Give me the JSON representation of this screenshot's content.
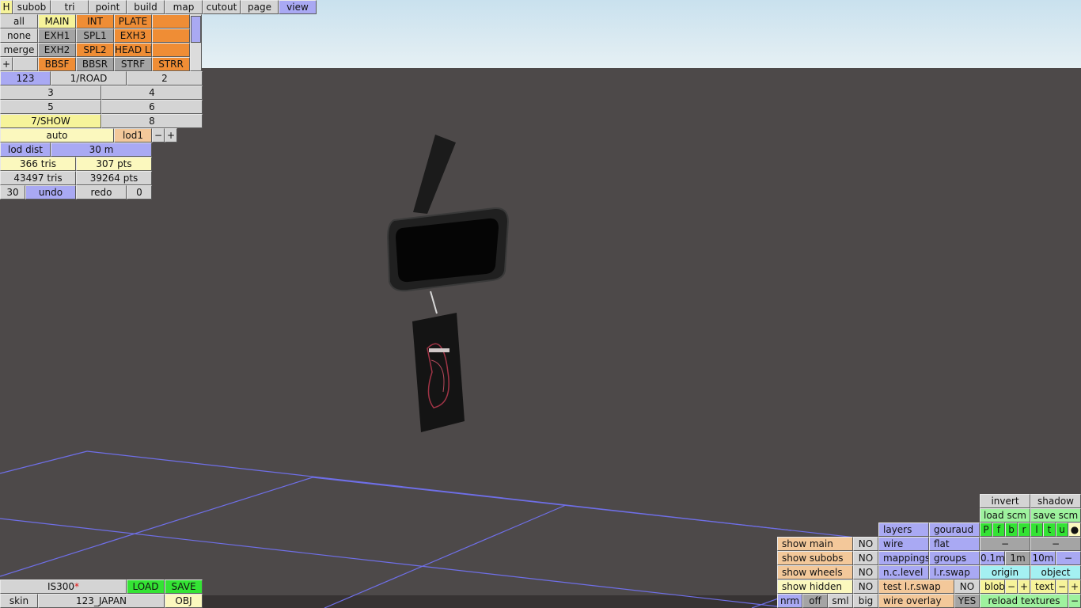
{
  "menu": {
    "h": "H",
    "items": [
      "subob",
      "tri",
      "point",
      "build",
      "map",
      "cutout",
      "page",
      "view"
    ]
  },
  "parts": {
    "row1": [
      "all",
      "MAIN",
      "INT",
      "PLATE",
      ""
    ],
    "row2": [
      "none",
      "EXH1",
      "SPL1",
      "EXH3",
      ""
    ],
    "row3": [
      "merge",
      "EXH2",
      "SPL2",
      "HEAD LI",
      ""
    ],
    "row4": [
      "+",
      "",
      "BBSF",
      "BBSR",
      "STRF",
      "STRR"
    ]
  },
  "groups": {
    "row1": [
      "123",
      "1/ROAD",
      "2"
    ],
    "row2": [
      "3",
      "4"
    ],
    "row3": [
      "5",
      "6"
    ],
    "row4": [
      "7/SHOW",
      "8"
    ]
  },
  "lod": {
    "mode": "auto",
    "level": "lod1",
    "minus": "−",
    "plus": "+",
    "dist_label": "lod dist",
    "dist_value": "30 m"
  },
  "stats": {
    "tris_sel": "366 tris",
    "pts_sel": "307 pts",
    "tris_total": "43497 tris",
    "pts_total": "39264 pts"
  },
  "history": {
    "count": "30",
    "undo": "undo",
    "redo": "redo",
    "redo_count": "0"
  },
  "file": {
    "name": "IS300",
    "modified_mark": "*",
    "load": "LOAD",
    "save": "SAVE",
    "skin_label": "skin",
    "skin_value": "123_JAPAN",
    "obj": "OBJ"
  },
  "view_panel": {
    "invert": "invert",
    "shadow": "shadow",
    "load_scm": "load scm",
    "save_scm": "save scm",
    "layers": "layers",
    "gouraud": "gouraud",
    "light_buttons": [
      "P",
      "f",
      "b",
      "r",
      "l",
      "t",
      "u",
      "●"
    ],
    "show_main": "show main",
    "show_main_val": "NO",
    "wire": "wire",
    "flat": "flat",
    "dash1": "−",
    "dash2": "−",
    "show_subobs": "show subobs",
    "show_subobs_val": "NO",
    "mappings": "mappings",
    "groups": "groups",
    "step_01": "0.1m",
    "step_1": "1m",
    "step_10": "10m",
    "step_minus": "−",
    "show_wheels": "show wheels",
    "show_wheels_val": "NO",
    "nc_level": "n.c.level",
    "lr_swap": "l.r.swap",
    "origin": "origin",
    "object": "object",
    "show_hidden": "show hidden",
    "show_hidden_val": "NO",
    "test_lr_swap": "test l.r.swap",
    "test_lr_swap_val": "NO",
    "blob": "blob",
    "blob_minus": "−",
    "blob_plus": "+",
    "text": "text",
    "text_minus": "−",
    "text_plus": "+",
    "nrm": "nrm",
    "off": "off",
    "sml": "sml",
    "big": "big",
    "wire_overlay": "wire overlay",
    "wire_overlay_val": "YES",
    "reload_textures": "reload textures",
    "reload_minus": "−"
  },
  "colors": {
    "viewport_bg": "#4d4949",
    "grid_line": "#6f6fe8",
    "model_body": "#1b1b1b"
  }
}
